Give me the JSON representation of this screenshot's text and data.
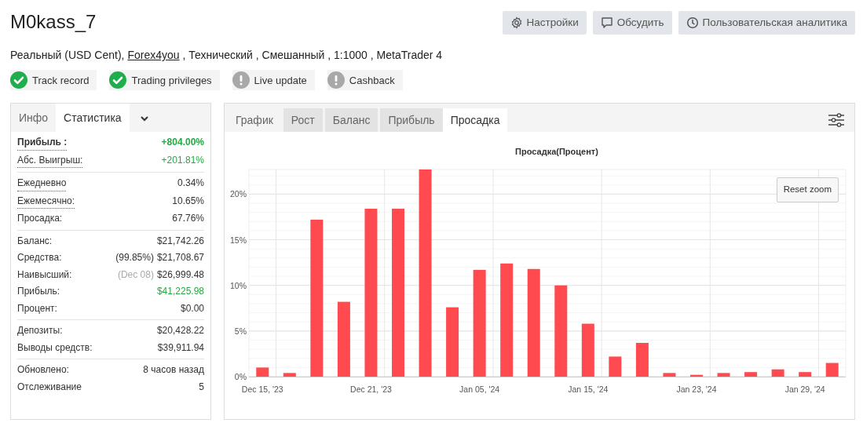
{
  "header": {
    "title": "M0kass_7",
    "buttons": [
      {
        "kind": "settings",
        "label": "Настройки"
      },
      {
        "kind": "discuss",
        "label": "Обсудить"
      },
      {
        "kind": "analytics",
        "label": "Пользовательская аналитика"
      }
    ]
  },
  "subtitle": {
    "before": "Реальный (USD Cent),",
    "link": "Forex4you",
    "after": ", Технический , Смешанный , 1:1000 , MetaTrader 4"
  },
  "badges": [
    {
      "label": "Track record",
      "verified": true
    },
    {
      "label": "Trading privileges",
      "verified": true
    },
    {
      "label": "Live update",
      "verified": false
    },
    {
      "label": "Cashback",
      "verified": false
    }
  ],
  "stats_panel": {
    "tabs": [
      {
        "label": "Инфо",
        "selected": false
      },
      {
        "label": "Статистика",
        "selected": true
      }
    ],
    "sections": [
      [
        {
          "label": "Прибыль :",
          "value": "+804.00%",
          "bold": true,
          "dotted": true,
          "positive": true
        },
        {
          "label": "Абс. Выигрыш:",
          "value": "+201.81%",
          "bold": false,
          "dotted": true,
          "positive": true
        }
      ],
      [
        {
          "label": "Ежедневно",
          "value": "0.34%",
          "bold": false,
          "dotted": true,
          "positive": false
        },
        {
          "label": "Ежемесячно:",
          "value": "10.65%",
          "bold": false,
          "dotted": true,
          "positive": false
        },
        {
          "label": "Просадка:",
          "value": "67.76%",
          "bold": false,
          "dotted": false,
          "positive": false
        }
      ],
      [
        {
          "label": "Баланс:",
          "value": "$21,742.26",
          "bold": false,
          "dotted": false,
          "positive": false
        },
        {
          "label": "Средства:",
          "note": "(99.85%)",
          "note_muted": false,
          "value": "$21,708.67",
          "bold": false,
          "dotted": false,
          "positive": false
        },
        {
          "label": "Наивысший:",
          "note": "(Dec 08)",
          "note_muted": true,
          "value": "$26,999.48",
          "bold": false,
          "dotted": false,
          "positive": false
        },
        {
          "label": "Прибыль:",
          "value": "$41,225.98",
          "bold": false,
          "dotted": false,
          "positive": true
        },
        {
          "label": "Процент:",
          "value": "$0.00",
          "bold": false,
          "dotted": false,
          "positive": false
        }
      ],
      [
        {
          "label": "Депозиты:",
          "value": "$20,428.22",
          "bold": false,
          "dotted": false,
          "positive": false
        },
        {
          "label": "Выводы средств:",
          "value": "$39,911.94",
          "bold": false,
          "dotted": false,
          "positive": false
        }
      ],
      [
        {
          "label": "Обновлено:",
          "value": "8 часов назад",
          "bold": false,
          "dotted": false,
          "positive": false
        },
        {
          "label": "Отслеживание",
          "value": "5",
          "bold": false,
          "dotted": false,
          "positive": false
        }
      ]
    ]
  },
  "chart_panel": {
    "tabs": [
      {
        "label": "График",
        "selected": false,
        "shaded": false
      },
      {
        "label": "Рост",
        "selected": false,
        "shaded": true
      },
      {
        "label": "Баланс",
        "selected": false,
        "shaded": true
      },
      {
        "label": "Прибыль",
        "selected": false,
        "shaded": true
      },
      {
        "label": "Просадка",
        "selected": true,
        "shaded": false
      }
    ],
    "reset_zoom": "Reset zoom",
    "chart_data": {
      "type": "bar",
      "title": "Просадка(Процент)",
      "categories": [
        "Dec 15, '23",
        null,
        null,
        null,
        "Dec 21, '23",
        null,
        null,
        null,
        "Jan 05, '24",
        null,
        null,
        null,
        "Jan 15, '24",
        null,
        null,
        null,
        "Jan 23, '24",
        null,
        null,
        null,
        "Jan 29, '24",
        null
      ],
      "grid": true,
      "series": [
        {
          "color": "#ff4a4f",
          "values": [
            1.0,
            0.4,
            17.2,
            8.2,
            18.4,
            18.4,
            22.7,
            7.6,
            11.7,
            12.4,
            11.8,
            10.0,
            5.8,
            2.2,
            3.7,
            0.4,
            0.2,
            0.4,
            0.5,
            0.8,
            0.5,
            1.5
          ]
        }
      ],
      "ylim": [
        0,
        22.7
      ],
      "yticks": [
        {
          "value": 0,
          "label": "0%"
        },
        {
          "value": 5,
          "label": "5%"
        },
        {
          "value": 10,
          "label": "10%"
        },
        {
          "value": 15,
          "label": "15%"
        },
        {
          "value": 20,
          "label": "20%"
        }
      ]
    }
  }
}
